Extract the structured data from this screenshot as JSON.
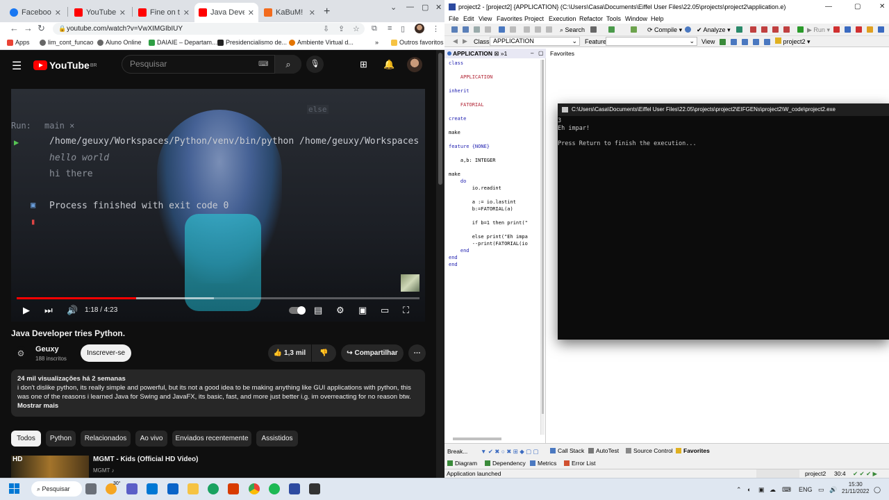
{
  "browser": {
    "tabs": [
      {
        "title": "Facebook",
        "color": "#1877f2"
      },
      {
        "title": "YouTube",
        "color": "#ff0000"
      },
      {
        "title": "Fine on the O",
        "color": "#ff0000"
      },
      {
        "title": "Java Develop",
        "color": "#ff0000",
        "active": true
      },
      {
        "title": "KaBuM! | Ma",
        "color": "#f26b1d"
      }
    ],
    "url": "youtube.com/watch?v=VwXIMGIbIUY",
    "bookmarks": [
      "Apps",
      "lim_cont_funcao",
      "Aluno Online",
      "DAIAIE – Departam...",
      "Presidencialismo de...",
      "Ambiente Virtual d...",
      "Outros favoritos"
    ]
  },
  "youtube": {
    "logo": "YouTube",
    "region": "BR",
    "search_placeholder": "Pesquisar",
    "video": {
      "overlay_run": "Run:",
      "overlay_tab": "main",
      "overlay_else": "else",
      "overlay_cmd": "/home/geuxy/Workspaces/Python/venv/bin/python /home/geuxy/Workspaces",
      "overlay_line1": "hello world",
      "overlay_line2": "hi there",
      "overlay_exit": "Process finished with exit code 0",
      "time": "1:18 / 4:23",
      "progress_fraction": 0.297,
      "buffered_fraction": 0.49
    },
    "title": "Java Developer tries Python.",
    "channel": {
      "name": "Geuxy",
      "subscribers": "188 inscritos"
    },
    "subscribe_label": "Inscrever-se",
    "likes": "1,3 mil",
    "share_label": "Compartilhar",
    "description": {
      "meta": "24 mil visualizações  há 2 semanas",
      "text": "i don't dislike python, its really simple and powerful, but its not a good idea to be making anything like GUI applications with python, this was one of the reasons i learned Java for Swing and JavaFX, its basic, fast, and more just better i.g. im overreacting for no reason btw.",
      "more": "Mostrar mais"
    },
    "chips": [
      "Todos",
      "Python",
      "Relacionados",
      "Ao vivo",
      "Enviados recentemente",
      "Assistidos"
    ],
    "recommendation": {
      "badge": "HD",
      "title": "MGMT - Kids (Official HD Video)",
      "channel": "MGMT ♪"
    }
  },
  "eiffel": {
    "title": "project2 - [project2] {APPLICATION} (C:\\Users\\Casa\\Documents\\Eiffel User Files\\22.05\\projects\\project2\\application.e)",
    "menu": [
      "File",
      "Edit",
      "View",
      "Favorites",
      "Project",
      "Execution",
      "Refactor",
      "Tools",
      "Window",
      "Help"
    ],
    "toolbar": {
      "search": "Search",
      "compile": "Compile",
      "analyze": "Analyze",
      "run": "Run"
    },
    "class_label": "Class",
    "class_value": "APPLICATION",
    "feature_label": "Feature",
    "view_label": "View",
    "project_value": "project2",
    "editor_tab": "APPLICATION",
    "editor_tab_extra": "1",
    "favorites_label": "Favorites",
    "code_lines": [
      {
        "t": "class",
        "c": "kw"
      },
      {
        "t": "",
        "c": ""
      },
      {
        "t": "    APPLICATION",
        "c": "cl"
      },
      {
        "t": "",
        "c": ""
      },
      {
        "t": "inherit",
        "c": "kw"
      },
      {
        "t": "",
        "c": ""
      },
      {
        "t": "    FATORIAL",
        "c": "cl"
      },
      {
        "t": "",
        "c": ""
      },
      {
        "t": "create",
        "c": "kw"
      },
      {
        "t": "",
        "c": ""
      },
      {
        "t": "make",
        "c": ""
      },
      {
        "t": "",
        "c": ""
      },
      {
        "t": "feature {NONE}",
        "c": "kw"
      },
      {
        "t": "",
        "c": ""
      },
      {
        "t": "    a,b: INTEGER",
        "c": ""
      },
      {
        "t": "",
        "c": ""
      },
      {
        "t": "make",
        "c": ""
      },
      {
        "t": "    do",
        "c": "kw"
      },
      {
        "t": "        io.readint",
        "c": ""
      },
      {
        "t": "",
        "c": ""
      },
      {
        "t": "        a := io.lastint",
        "c": ""
      },
      {
        "t": "        b:=FATORIAL(a)",
        "c": ""
      },
      {
        "t": "",
        "c": ""
      },
      {
        "t": "        if b=1 then print(\"",
        "c": ""
      },
      {
        "t": "",
        "c": ""
      },
      {
        "t": "        else print(\"Eh impa",
        "c": ""
      },
      {
        "t": "        --print(FATORIAL(io",
        "c": ""
      },
      {
        "t": "    end",
        "c": "kw"
      },
      {
        "t": "end",
        "c": "kw"
      },
      {
        "t": "end",
        "c": "kw"
      }
    ],
    "console": {
      "title": "C:\\Users\\Casa\\Documents\\Eiffel User Files\\22.05\\projects\\project2\\EIFGENs\\project2\\W_code\\project2.exe",
      "lines": [
        "3",
        "Eh impar!",
        "",
        "Press Return to finish the execution..."
      ]
    },
    "break_label": "Break...",
    "bottom_tabs": [
      "Call Stack",
      "AutoTest",
      "Source Control",
      "Favorites"
    ],
    "bottom_tabs2": [
      "Diagram",
      "Dependency",
      "Metrics",
      "Error List"
    ],
    "status": {
      "message": "Application launched",
      "project": "project2",
      "position": "30:4"
    }
  },
  "taskbar": {
    "search_label": "Pesquisar",
    "weather": "30°",
    "lang": "ENG",
    "time": "15:30",
    "date": "21/11/2022"
  }
}
